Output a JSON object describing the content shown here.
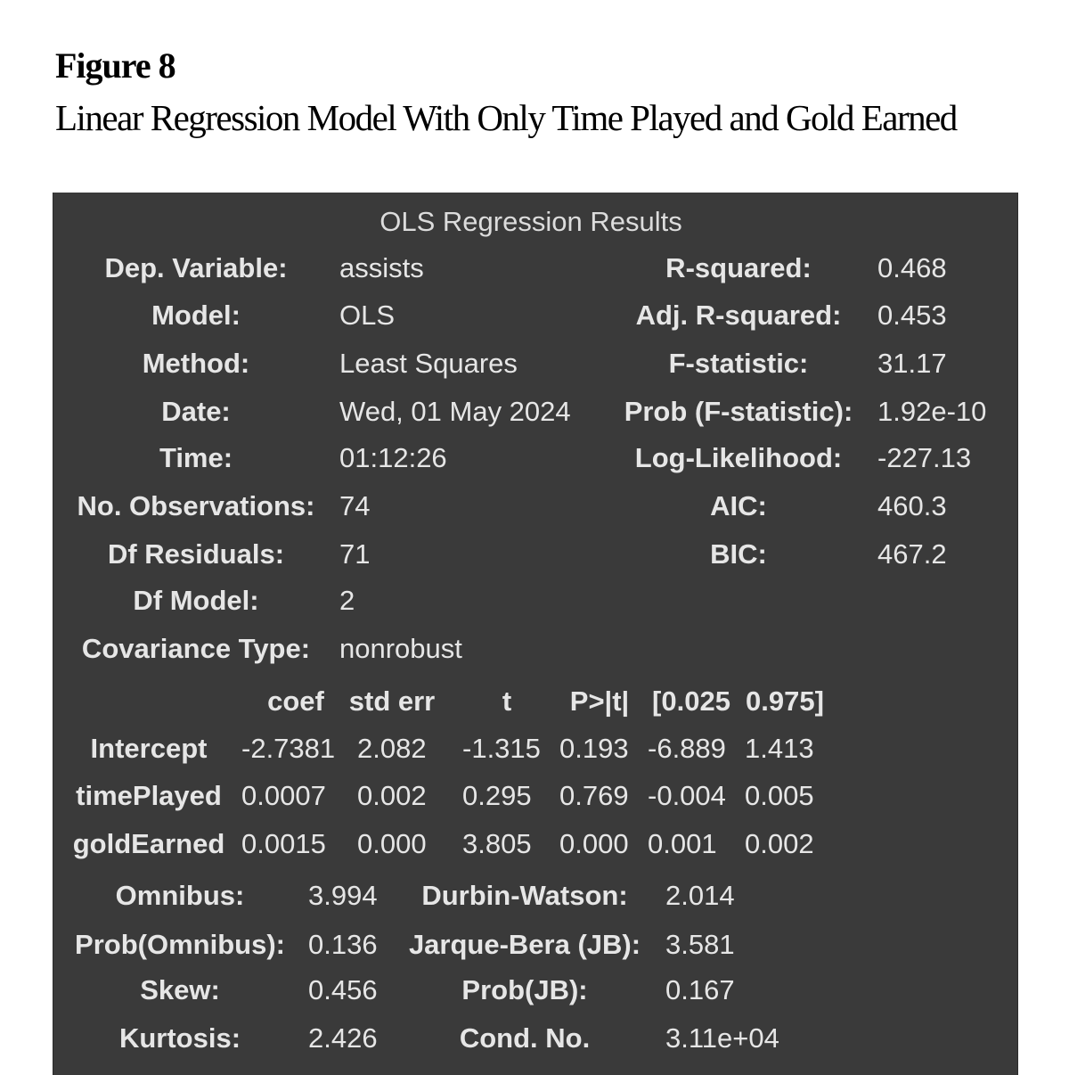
{
  "figure": {
    "label": "Figure 8",
    "caption": "Linear Regression Model With Only Time Played and Gold Earned"
  },
  "table": {
    "title": "OLS Regression Results",
    "summary_left": [
      {
        "label": "Dep. Variable:",
        "value": "assists"
      },
      {
        "label": "Model:",
        "value": "OLS"
      },
      {
        "label": "Method:",
        "value": "Least Squares"
      },
      {
        "label": "Date:",
        "value": "Wed, 01 May 2024"
      },
      {
        "label": "Time:",
        "value": "01:12:26"
      },
      {
        "label": "No. Observations:",
        "value": "74"
      },
      {
        "label": "Df Residuals:",
        "value": "71"
      },
      {
        "label": "Df Model:",
        "value": "2"
      },
      {
        "label": "Covariance Type:",
        "value": "nonrobust"
      }
    ],
    "summary_right": [
      {
        "label": "R-squared:",
        "value": "0.468"
      },
      {
        "label": "Adj. R-squared:",
        "value": "0.453"
      },
      {
        "label": "F-statistic:",
        "value": "31.17"
      },
      {
        "label": "Prob (F-statistic):",
        "value": "1.92e-10"
      },
      {
        "label": "Log-Likelihood:",
        "value": "-227.13"
      },
      {
        "label": "AIC:",
        "value": "460.3"
      },
      {
        "label": "BIC:",
        "value": "467.2"
      }
    ],
    "coef_headers": [
      "coef",
      "std err",
      "t",
      "P>|t|",
      "[0.025",
      "0.975]"
    ],
    "coef_rows": [
      {
        "name": "Intercept",
        "values": [
          "-2.7381",
          "2.082",
          "-1.315",
          "0.193",
          "-6.889",
          "1.413"
        ]
      },
      {
        "name": "timePlayed",
        "values": [
          "0.0007",
          "0.002",
          "0.295",
          "0.769",
          "-0.004",
          "0.005"
        ]
      },
      {
        "name": "goldEarned",
        "values": [
          "0.0015",
          "0.000",
          "3.805",
          "0.000",
          "0.001",
          "0.002"
        ]
      }
    ],
    "diagnostics": [
      {
        "label1": "Omnibus:",
        "value1": "3.994",
        "label2": "Durbin-Watson:",
        "value2": "2.014"
      },
      {
        "label1": "Prob(Omnibus):",
        "value1": "0.136",
        "label2": "Jarque-Bera (JB):",
        "value2": "3.581"
      },
      {
        "label1": "Skew:",
        "value1": "0.456",
        "label2": "Prob(JB):",
        "value2": "0.167"
      },
      {
        "label1": "Kurtosis:",
        "value1": "2.426",
        "label2": "Cond. No.",
        "value2": "3.11e+04"
      }
    ]
  }
}
